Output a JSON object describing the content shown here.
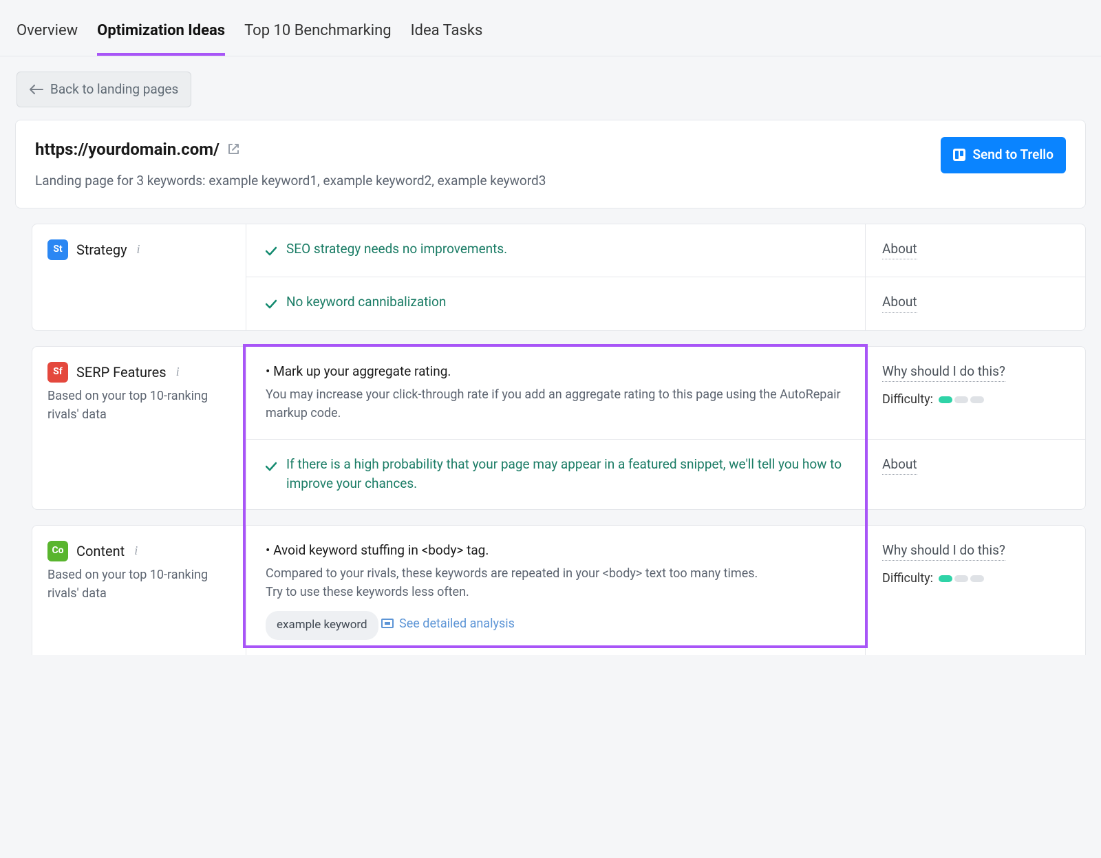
{
  "tabs": {
    "overview": "Overview",
    "optimization": "Optimization Ideas",
    "benchmarking": "Top 10 Benchmarking",
    "tasks": "Idea Tasks"
  },
  "back_button": "Back to landing pages",
  "header": {
    "url": "https://yourdomain.com/",
    "subhead": "Landing page for 3 keywords: example keyword1, example keyword2, example keyword3",
    "trello_button": "Send to Trello"
  },
  "labels": {
    "about": "About",
    "why": "Why should I do this?",
    "difficulty": "Difficulty:",
    "detailed": "See detailed analysis"
  },
  "sections": {
    "strategy": {
      "badge": "St",
      "title": "Strategy",
      "rows": [
        {
          "text": "SEO strategy needs no improvements."
        },
        {
          "text": "No keyword cannibalization"
        }
      ]
    },
    "serp": {
      "badge": "Sf",
      "title": "SERP Features",
      "desc": "Based on your top 10-ranking rivals' data",
      "row1": {
        "title": "Mark up your aggregate rating.",
        "body": "You may increase your click-through rate if you add an aggregate rating to this page using the AutoRepair markup code."
      },
      "row2": {
        "text": "If there is a high probability that your page may appear in a featured snippet, we'll tell you how to improve your chances."
      }
    },
    "content": {
      "badge": "Co",
      "title": "Content",
      "desc": "Based on your top 10-ranking rivals' data",
      "row1": {
        "title": "Avoid keyword stuffing in <body> tag.",
        "body1": "Compared to your rivals, these keywords are repeated in your <body> text too many times.",
        "body2": "Try to use these keywords less often.",
        "chip": "example keyword"
      }
    }
  }
}
